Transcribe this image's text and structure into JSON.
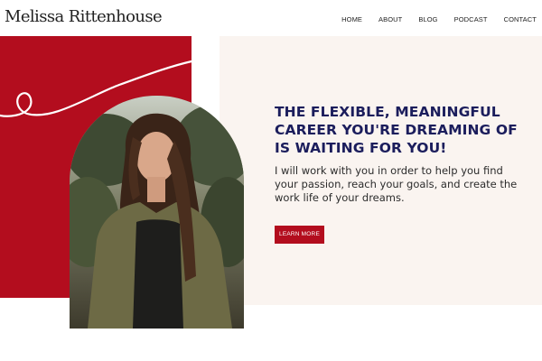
{
  "header": {
    "site_title": "Melissa Rittenhouse",
    "nav": [
      {
        "label": "HOME"
      },
      {
        "label": "ABOUT"
      },
      {
        "label": "BLOG"
      },
      {
        "label": "PODCAST"
      },
      {
        "label": "CONTACT"
      }
    ]
  },
  "hero": {
    "heading": "THE FLEXIBLE, MEANINGFUL CAREER YOU'RE DREAMING OF IS WAITING FOR YOU!",
    "body": "I will work with you in order to help you find your passion, reach your goals, and create the work life of your dreams.",
    "cta_label": "LEARN MORE"
  },
  "colors": {
    "accent_red": "#b30d1e",
    "heading_navy": "#1b1d5c",
    "cream": "#faf4f0"
  }
}
